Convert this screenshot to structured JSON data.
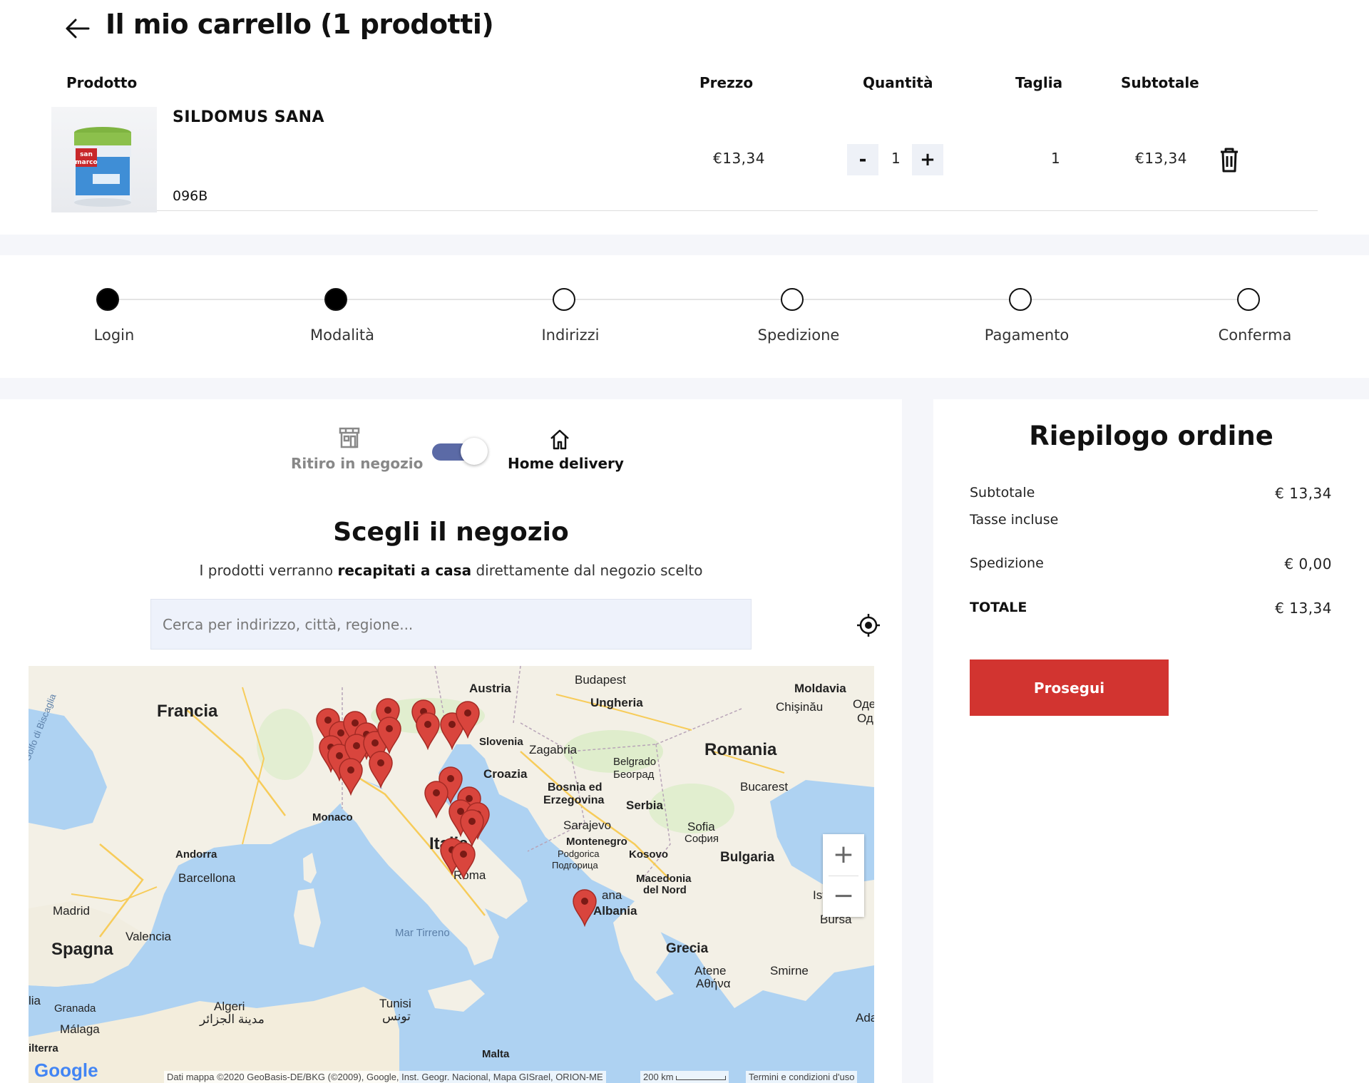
{
  "cart": {
    "title": "Il mio carrello (1 prodotti)",
    "columns": {
      "product": "Prodotto",
      "price": "Prezzo",
      "quantity": "Quantità",
      "size": "Taglia",
      "subtotal": "Subtotale"
    },
    "item": {
      "name": "SILDOMUS SANA",
      "code": "096B",
      "price": "€13,34",
      "quantity": "1",
      "decrement": "-",
      "increment": "+",
      "size": "1",
      "subtotal": "€13,34",
      "image_brand_top": "san",
      "image_brand_bottom": "marco"
    }
  },
  "steps": [
    {
      "label": "Login",
      "done": true
    },
    {
      "label": "Modalità",
      "done": true
    },
    {
      "label": "Indirizzi",
      "done": false
    },
    {
      "label": "Spedizione",
      "done": false
    },
    {
      "label": "Pagamento",
      "done": false
    },
    {
      "label": "Conferma",
      "done": false
    }
  ],
  "delivery": {
    "pickup_label": "Ritiro in negozio",
    "home_label": "Home delivery",
    "toggle_selected": "Home delivery",
    "title": "Scegli il negozio",
    "subtitle_before": "I prodotti verranno",
    "subtitle_bold": "recapitati a casa",
    "subtitle_after": "direttamente dal negozio scelto",
    "search_placeholder": "Cerca per indirizzo, città, regione..."
  },
  "map": {
    "labels": {
      "francia": "Francia",
      "romania": "Romania",
      "spagna": "Spagna",
      "italia": "Italia",
      "austria": "Austria",
      "budapest": "Budapest",
      "ungheria": "Ungheria",
      "moldavia": "Moldavia",
      "chisinau": "Chişinău",
      "odesa": "Оде",
      "od": "Од",
      "slovenia": "Slovenia",
      "zagabria": "Zagabria",
      "croazia": "Croazia",
      "belgrado": "Belgrado",
      "belgrado_cyr": "Београд",
      "bosnia": "Bosnia ed",
      "erzegovina": "Erzegovina",
      "serbia": "Serbia",
      "bucarest": "Bucarest",
      "sarajevo": "Sarajevo",
      "sofia": "Sofia",
      "sofia_cyr": "София",
      "montenegro": "Montenegro",
      "podgorica": "Podgorica",
      "podgorica_cyr": "Подгорица",
      "kosovo": "Kosovo",
      "bulgaria": "Bulgaria",
      "macedonia": "Macedonia",
      "del_nord": "del Nord",
      "monaco": "Monaco",
      "andorra": "Andorra",
      "barcellona": "Barcellona",
      "madrid": "Madrid",
      "valencia": "Valencia",
      "roma": "Roma",
      "tirana": "ana",
      "albania": "Albania",
      "mar_tirreno": "Mar Tirreno",
      "grecia": "Grecia",
      "atene": "Atene",
      "atene_gr": "Αθήνα",
      "smirne": "Smirne",
      "algeri": "Algeri",
      "algeri_ar": "مدينة الجزائر",
      "tunisi": "Tunisi",
      "tunisi_ar": "تونس",
      "granada": "Granada",
      "malaga": "Málaga",
      "malta": "Malta",
      "golfo": "Golfo di Biscaglia",
      "istanbul": "Ist",
      "bursa": "Bursa",
      "ada": "Ada",
      "lia": "lia",
      "ilterra": "ilterra"
    },
    "zoom_in": "+",
    "zoom_out": "−",
    "google": "Google",
    "attribution": "Dati mappa ©2020 GeoBasis-DE/BKG (©2009), Google, Inst. Geogr. Nacional, Mapa GISrael, ORION-ME",
    "scale": "200 km",
    "terms": "Termini e condizioni d'uso",
    "pin_color": "#d9453d"
  },
  "summary": {
    "title": "Riepilogo ordine",
    "subtotal_label": "Subtotale",
    "subtotal_value": "€ 13,34",
    "tax_label": "Tasse incluse",
    "shipping_label": "Spedizione",
    "shipping_value": "€ 0,00",
    "total_label": "TOTALE",
    "total_value": "€ 13,34",
    "proceed_label": "Prosegui"
  },
  "colors": {
    "accent_red": "#d23430",
    "toggle": "#5b6aa6",
    "page_bg": "#f5f6fa"
  }
}
